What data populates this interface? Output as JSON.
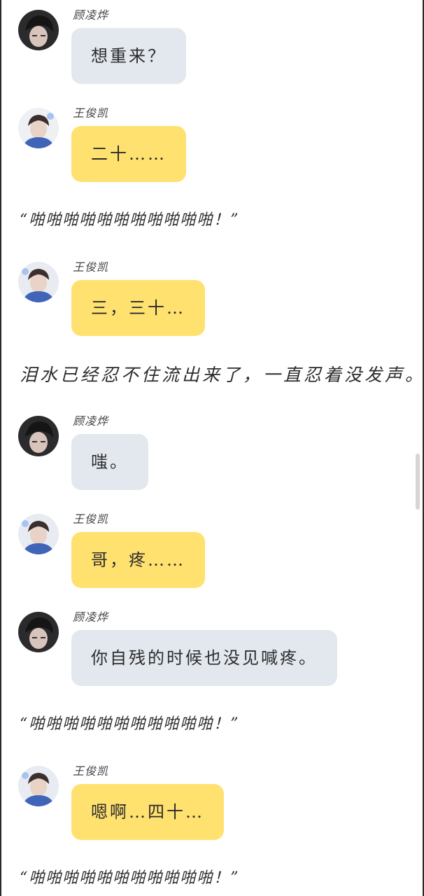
{
  "colors": {
    "bubble_gray": "#e3e8ef",
    "bubble_yellow": "#ffe16f",
    "text": "#2c2c2c",
    "scrollbar": "#d6d6d6"
  },
  "feed": [
    {
      "type": "message",
      "sender": "顾凌烨",
      "text": "想重来？",
      "bubble": "gray",
      "avatar": "avatar-dark-hair"
    },
    {
      "type": "message",
      "sender": "王俊凯",
      "text": "二十……",
      "bubble": "yellow",
      "avatar": "avatar-blue-shirt"
    },
    {
      "type": "narration",
      "text": "“啪啪啪啪啪啪啪啪啪啪啪！”"
    },
    {
      "type": "message",
      "sender": "王俊凯",
      "text": "三，三十…",
      "bubble": "yellow",
      "avatar": "avatar-blue-shirt"
    },
    {
      "type": "narration",
      "text": "泪水已经忍不住流出来了，一直忍着没发声。"
    },
    {
      "type": "message",
      "sender": "顾凌烨",
      "text": "嗤。",
      "bubble": "gray",
      "avatar": "avatar-dark-hair"
    },
    {
      "type": "message",
      "sender": "王俊凯",
      "text": "哥，疼……",
      "bubble": "yellow",
      "avatar": "avatar-blue-shirt"
    },
    {
      "type": "message",
      "sender": "顾凌烨",
      "text": "你自残的时候也没见喊疼。",
      "bubble": "gray",
      "avatar": "avatar-dark-hair"
    },
    {
      "type": "narration",
      "text": "“啪啪啪啪啪啪啪啪啪啪啪！”"
    },
    {
      "type": "message",
      "sender": "王俊凯",
      "text": "嗯啊…四十…",
      "bubble": "yellow",
      "avatar": "avatar-blue-shirt"
    },
    {
      "type": "narration",
      "text": "“啪啪啪啪啪啪啪啪啪啪啪！”"
    }
  ]
}
